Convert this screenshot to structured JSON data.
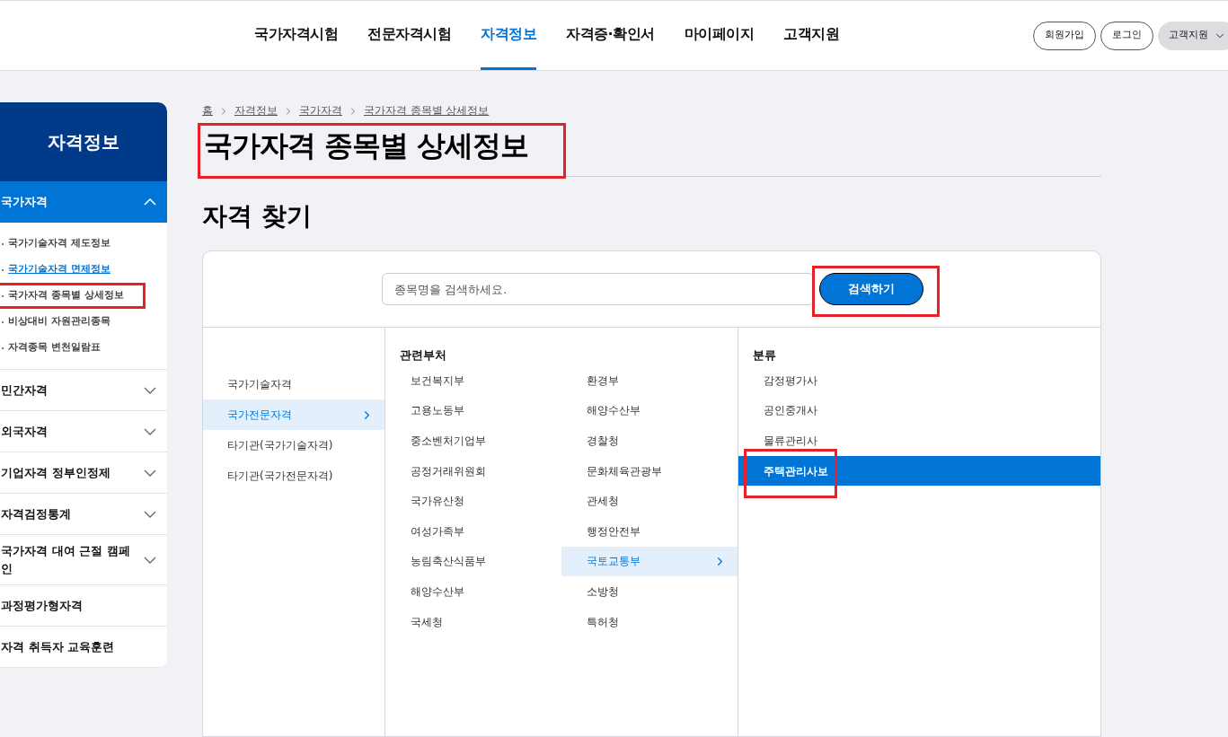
{
  "header": {
    "nav": [
      {
        "label": "국가자격시험",
        "selected": false
      },
      {
        "label": "전문자격시험",
        "selected": false
      },
      {
        "label": "자격정보",
        "selected": true
      },
      {
        "label": "자격증·확인서",
        "selected": false
      },
      {
        "label": "마이페이지",
        "selected": false
      },
      {
        "label": "고객지원",
        "selected": false
      }
    ],
    "buttons": [
      {
        "label": "회원가입",
        "kind": "outline"
      },
      {
        "label": "로그인",
        "kind": "outline"
      },
      {
        "label": "고객지원",
        "kind": "dropdown"
      }
    ]
  },
  "sidebar": {
    "title": "자격정보",
    "sections": [
      {
        "label": "국가자격",
        "kind": "group",
        "expanded": true,
        "children": [
          {
            "label": "국가기술자격 제도정보",
            "hovered": false,
            "highlighted": false
          },
          {
            "label": "국가기술자격 면제정보",
            "hovered": true,
            "highlighted": false
          },
          {
            "label": "국가자격 종목별 상세정보",
            "hovered": false,
            "highlighted": true
          },
          {
            "label": "비상대비 자원관리종목",
            "hovered": false,
            "highlighted": false
          },
          {
            "label": "자격종목 변천일람표",
            "hovered": false,
            "highlighted": false
          }
        ]
      },
      {
        "label": "민간자격",
        "kind": "group",
        "expanded": false
      },
      {
        "label": "외국자격",
        "kind": "group",
        "expanded": false
      },
      {
        "label": "기업자격 정부인정제",
        "kind": "group",
        "expanded": false
      },
      {
        "label": "자격검정통계",
        "kind": "group",
        "expanded": false
      },
      {
        "label": "국가자격 대여 근절 캠페인",
        "kind": "group",
        "expanded": false
      },
      {
        "label": "과정평가형자격",
        "kind": "link"
      },
      {
        "label": "자격 취득자 교육훈련",
        "kind": "link"
      }
    ]
  },
  "breadcrumb": [
    "홈",
    "자격정보",
    "국가자격",
    "국가자격 종목별 상세정보"
  ],
  "page_title": {
    "text": "국가자격 종목별 상세정보",
    "highlighted": true
  },
  "section_title": "자격 찾기",
  "search": {
    "placeholder": "종목명을 검색하세요.",
    "button": "검색하기",
    "button_highlighted": true
  },
  "types": [
    {
      "label": "국가기술자격",
      "selected": false
    },
    {
      "label": "국가전문자격",
      "selected": true
    },
    {
      "label": "타기관(국가기술자격)",
      "selected": false
    },
    {
      "label": "타기관(국가전문자격)",
      "selected": false
    }
  ],
  "ministries": {
    "heading": "관련부처",
    "items": [
      {
        "label": "보건복지부",
        "selected": false
      },
      {
        "label": "환경부",
        "selected": false
      },
      {
        "label": "고용노동부",
        "selected": false
      },
      {
        "label": "해양수산부",
        "selected": false
      },
      {
        "label": "중소벤처기업부",
        "selected": false
      },
      {
        "label": "경찰청",
        "selected": false
      },
      {
        "label": "공정거래위원회",
        "selected": false
      },
      {
        "label": "문화체육관광부",
        "selected": false
      },
      {
        "label": "국가유산청",
        "selected": false
      },
      {
        "label": "관세청",
        "selected": false
      },
      {
        "label": "여성가족부",
        "selected": false
      },
      {
        "label": "행정안전부",
        "selected": false
      },
      {
        "label": "농림축산식품부",
        "selected": false
      },
      {
        "label": "국토교통부",
        "selected": true
      },
      {
        "label": "해양수산부",
        "selected": false
      },
      {
        "label": "소방청",
        "selected": false
      },
      {
        "label": "국세청",
        "selected": false
      },
      {
        "label": "특허청",
        "selected": false
      }
    ]
  },
  "categories": {
    "heading": "분류",
    "items": [
      {
        "label": "감정평가사",
        "selected": false,
        "highlighted": false
      },
      {
        "label": "공인중개사",
        "selected": false,
        "highlighted": false
      },
      {
        "label": "물류관리사",
        "selected": false,
        "highlighted": false
      },
      {
        "label": "주택관리사보",
        "selected": true,
        "highlighted": true
      }
    ]
  }
}
